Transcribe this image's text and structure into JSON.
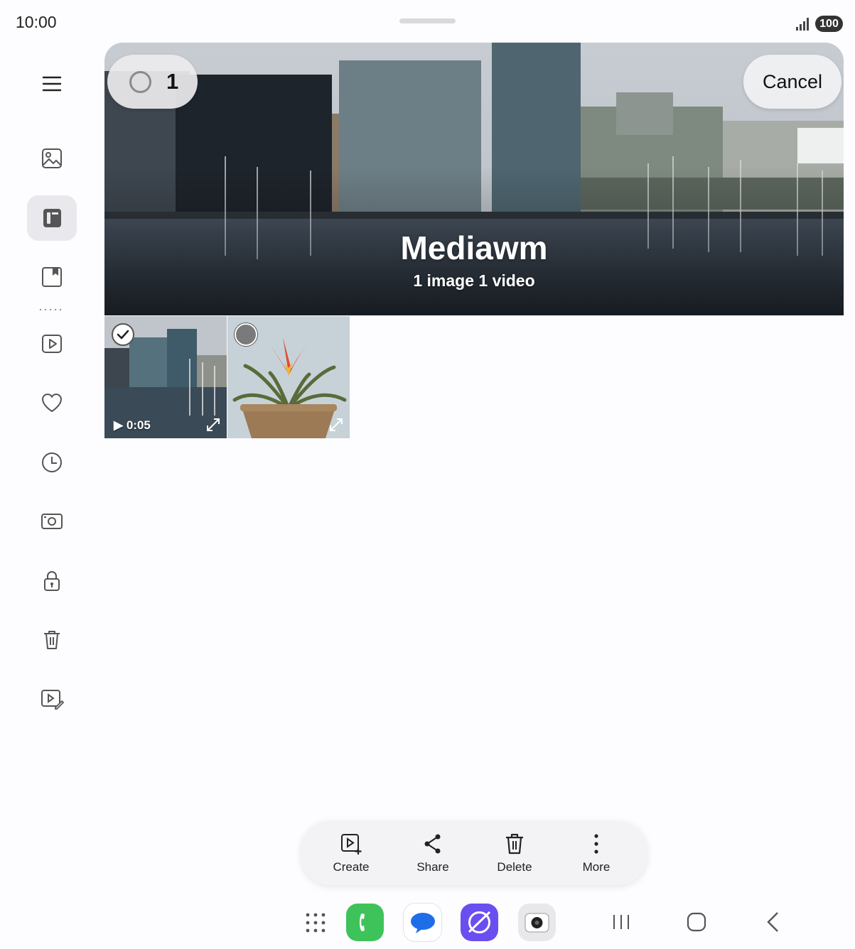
{
  "status_bar": {
    "time": "10:00",
    "battery": "100"
  },
  "album": {
    "title": "Mediawm",
    "subtitle": "1 image 1 video"
  },
  "selection": {
    "count": "1"
  },
  "cancel_label": "Cancel",
  "thumbnails": [
    {
      "kind": "video",
      "duration": "0:05",
      "selected": true
    },
    {
      "kind": "image",
      "selected": false
    }
  ],
  "actions": {
    "create": "Create",
    "share": "Share",
    "delete": "Delete",
    "more": "More"
  },
  "sidebar": [
    "menu-icon",
    "pictures-icon",
    "albums-icon",
    "stories-icon",
    "videos-icon",
    "favourites-icon",
    "recent-icon",
    "screenshots-icon",
    "secure-folder-icon",
    "recycle-bin-icon",
    "video-editor-icon"
  ],
  "colors": {
    "accent_active_bg": "#e9e8ec",
    "phone_app": "#3ec35a",
    "messages_app": "#1f6ee8",
    "internet_app": "#6a4ef0"
  }
}
